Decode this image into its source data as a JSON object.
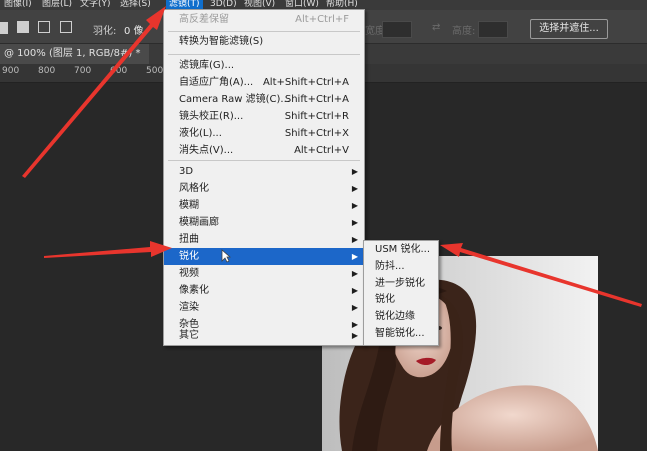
{
  "menubar": {
    "items": [
      {
        "label": "图像(I)"
      },
      {
        "label": "图层(L)"
      },
      {
        "label": "文字(Y)"
      },
      {
        "label": "选择(S)"
      },
      {
        "label": "滤镜(T)"
      },
      {
        "label": "3D(D)"
      },
      {
        "label": "视图(V)"
      },
      {
        "label": "窗口(W)"
      },
      {
        "label": "帮助(H)"
      }
    ]
  },
  "options": {
    "feather_label": "羽化:",
    "feather_value": "0 像",
    "width_label": "宽度:",
    "height_label": "高度:",
    "select_mask_button": "选择并遮住..."
  },
  "document_tab": "@ 100% (图层 1, RGB/8#) *",
  "ruler": [
    "900",
    "800",
    "700",
    "600",
    "500"
  ],
  "filter_menu": {
    "items": [
      {
        "label": "高反差保留",
        "shortcut": "Alt+Ctrl+F"
      },
      {
        "label": "转换为智能滤镜(S)",
        "shortcut": ""
      },
      {
        "label": "滤镜库(G)...",
        "shortcut": ""
      },
      {
        "label": "自适应广角(A)...",
        "shortcut": "Alt+Shift+Ctrl+A"
      },
      {
        "label": "Camera Raw 滤镜(C)...",
        "shortcut": "Shift+Ctrl+A"
      },
      {
        "label": "镜头校正(R)...",
        "shortcut": "Shift+Ctrl+R"
      },
      {
        "label": "液化(L)...",
        "shortcut": "Shift+Ctrl+X"
      },
      {
        "label": "消失点(V)...",
        "shortcut": "Alt+Ctrl+V"
      },
      {
        "label": "3D",
        "submenu": true
      },
      {
        "label": "风格化",
        "submenu": true
      },
      {
        "label": "模糊",
        "submenu": true
      },
      {
        "label": "模糊画廊",
        "submenu": true
      },
      {
        "label": "扭曲",
        "submenu": true
      },
      {
        "label": "锐化",
        "submenu": true,
        "highlighted": true
      },
      {
        "label": "视频",
        "submenu": true
      },
      {
        "label": "像素化",
        "submenu": true
      },
      {
        "label": "渲染",
        "submenu": true
      },
      {
        "label": "杂色",
        "submenu": true
      },
      {
        "label": "其它",
        "submenu": true
      }
    ]
  },
  "sharpen_submenu": {
    "items": [
      {
        "label": "USM 锐化..."
      },
      {
        "label": "防抖..."
      },
      {
        "label": "进一步锐化"
      },
      {
        "label": "锐化"
      },
      {
        "label": "锐化边缘"
      },
      {
        "label": "智能锐化..."
      }
    ]
  },
  "colors": {
    "menu_bg": "#f0f0f0",
    "highlight": "#1c67c9",
    "annotation_arrow": "#e8352d"
  }
}
